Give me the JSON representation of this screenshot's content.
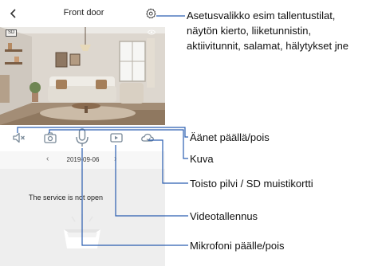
{
  "app": {
    "title": "Front door",
    "sd_badge": "SD",
    "date": "2019-09-06",
    "date_prev": "‹",
    "date_next": "›",
    "service_message": "The service is not open"
  },
  "icons": {
    "back": "chevron-left-icon",
    "settings": "gear-icon",
    "privacy": "eye-icon",
    "sound": "speaker-mute-icon",
    "snapshot": "camera-icon",
    "microphone": "microphone-icon",
    "record": "video-record-icon",
    "playback": "cloud-playback-icon"
  },
  "annotations": {
    "settings": [
      "Asetusvalikko esim tallentustilat,",
      "näytön kierto, liiketunnistin,",
      "aktiivitunnit, salamat, hälytykset jne"
    ],
    "sound": "Äänet päällä/pois",
    "snapshot": "Kuva",
    "playback": "Toisto pilvi / SD muistikortti",
    "record": "Videotallennus",
    "microphone": "Mikrofoni päälle/pois"
  },
  "colors": {
    "annotation_line": "#2a5db0",
    "icon": "#7a8a99",
    "app_background": "#eeeeee"
  }
}
